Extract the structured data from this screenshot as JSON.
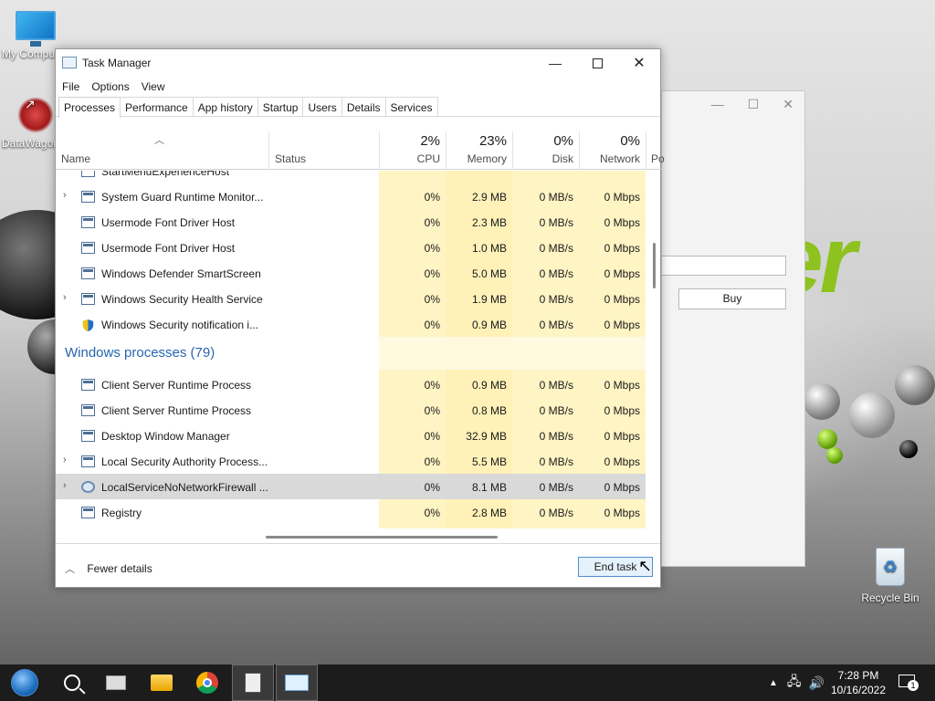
{
  "desktop": {
    "icons": {
      "my_computer": "My Compu",
      "datawagon": "DataWagon",
      "recycle_bin": "Recycle Bin"
    },
    "brand_text": "cer"
  },
  "background_window": {
    "buy_label": "Buy"
  },
  "task_manager": {
    "title": "Task Manager",
    "menu": [
      "File",
      "Options",
      "View"
    ],
    "tabs": [
      "Processes",
      "Performance",
      "App history",
      "Startup",
      "Users",
      "Details",
      "Services"
    ],
    "active_tab": "Processes",
    "columns": {
      "name": "Name",
      "status": "Status",
      "cpu": {
        "pct": "2%",
        "label": "CPU"
      },
      "memory": {
        "pct": "23%",
        "label": "Memory"
      },
      "disk": {
        "pct": "0%",
        "label": "Disk"
      },
      "network": {
        "pct": "0%",
        "label": "Network"
      },
      "power": "Po"
    },
    "rows_top": [
      {
        "name": "StartMenuExperienceHost",
        "expand": false,
        "icon": "app-icon",
        "cpu": "",
        "mem": "",
        "disk": "",
        "net": "",
        "clipped": true
      },
      {
        "name": "System Guard Runtime Monitor...",
        "expand": true,
        "icon": "app-icon",
        "cpu": "0%",
        "mem": "2.9 MB",
        "disk": "0 MB/s",
        "net": "0 Mbps"
      },
      {
        "name": "Usermode Font Driver Host",
        "expand": false,
        "icon": "app-icon",
        "cpu": "0%",
        "mem": "2.3 MB",
        "disk": "0 MB/s",
        "net": "0 Mbps"
      },
      {
        "name": "Usermode Font Driver Host",
        "expand": false,
        "icon": "app-icon",
        "cpu": "0%",
        "mem": "1.0 MB",
        "disk": "0 MB/s",
        "net": "0 Mbps"
      },
      {
        "name": "Windows Defender SmartScreen",
        "expand": false,
        "icon": "app-icon",
        "cpu": "0%",
        "mem": "5.0 MB",
        "disk": "0 MB/s",
        "net": "0 Mbps"
      },
      {
        "name": "Windows Security Health Service",
        "expand": true,
        "icon": "app-icon",
        "cpu": "0%",
        "mem": "1.9 MB",
        "disk": "0 MB/s",
        "net": "0 Mbps"
      },
      {
        "name": "Windows Security notification i...",
        "expand": false,
        "icon": "shield-icon",
        "cpu": "0%",
        "mem": "0.9 MB",
        "disk": "0 MB/s",
        "net": "0 Mbps"
      }
    ],
    "group_label": "Windows processes (79)",
    "rows_windows": [
      {
        "name": "Client Server Runtime Process",
        "expand": false,
        "icon": "app-icon",
        "cpu": "0%",
        "mem": "0.9 MB",
        "disk": "0 MB/s",
        "net": "0 Mbps"
      },
      {
        "name": "Client Server Runtime Process",
        "expand": false,
        "icon": "app-icon",
        "cpu": "0%",
        "mem": "0.8 MB",
        "disk": "0 MB/s",
        "net": "0 Mbps"
      },
      {
        "name": "Desktop Window Manager",
        "expand": false,
        "icon": "app-icon",
        "cpu": "0%",
        "mem": "32.9 MB",
        "disk": "0 MB/s",
        "net": "0 Mbps"
      },
      {
        "name": "Local Security Authority Process...",
        "expand": true,
        "icon": "app-icon",
        "cpu": "0%",
        "mem": "5.5 MB",
        "disk": "0 MB/s",
        "net": "0 Mbps"
      },
      {
        "name": "LocalServiceNoNetworkFirewall ...",
        "expand": true,
        "icon": "gear-icon",
        "cpu": "0%",
        "mem": "8.1 MB",
        "disk": "0 MB/s",
        "net": "0 Mbps",
        "selected": true
      },
      {
        "name": "Registry",
        "expand": false,
        "icon": "app-icon",
        "cpu": "0%",
        "mem": "2.8 MB",
        "disk": "0 MB/s",
        "net": "0 Mbps"
      }
    ],
    "footer": {
      "fewer_details": "Fewer details",
      "end_task": "End task"
    }
  },
  "taskbar": {
    "clock_time": "7:28 PM",
    "clock_date": "10/16/2022",
    "notification_count": "1"
  },
  "colors": {
    "accent_blue": "#2766b0",
    "usage_yellow": "#fff4c4",
    "usage_yellow_light": "#fff9e0",
    "selected_row": "#d9d9d9",
    "brand_green": "#8dc21f"
  }
}
